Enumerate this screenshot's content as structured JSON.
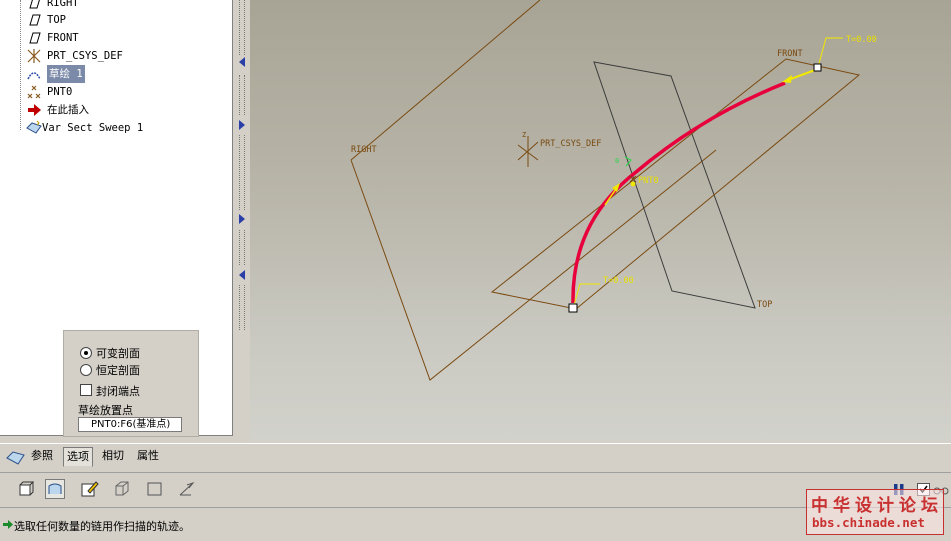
{
  "model_tree": {
    "items": [
      {
        "label": "RIGHT",
        "icon": "datum-plane-icon"
      },
      {
        "label": "TOP",
        "icon": "datum-plane-icon"
      },
      {
        "label": "FRONT",
        "icon": "datum-plane-icon"
      },
      {
        "label": "PRT_CSYS_DEF",
        "icon": "coordinate-system-icon"
      },
      {
        "label": "草绘 1",
        "icon": "sketch-icon",
        "selected": true
      },
      {
        "label": "PNT0",
        "icon": "datum-point-icon"
      },
      {
        "label": "在此插入",
        "icon": "insert-here-arrow-icon"
      },
      {
        "label": "Var Sect Sweep 1",
        "icon": "sweep-feature-icon"
      }
    ]
  },
  "viewport": {
    "labels": {
      "right_plane": "RIGHT",
      "top_plane": "TOP",
      "front_plane": "FRONT",
      "csys": "PRT_CSYS_DEF",
      "csys_axis": "Z",
      "point": "PNT0",
      "t_end": "T=0.00",
      "t_start": "T=0.00"
    },
    "colors": {
      "datum_plane": "#7a4a10",
      "trajectory": "#e8003c",
      "annotation": "#f0e800",
      "top_plane_edge": "#3c3c3c"
    }
  },
  "options_panel": {
    "radio_variable": "可变剖面",
    "radio_constant": "恒定剖面",
    "checkbox_closed_ends": "封闭端点",
    "sketch_placement_label": "草绘放置点",
    "sketch_placement_value": "PNT0:F6(基准点)",
    "selected": "variable"
  },
  "dashboard_tabs": [
    {
      "label": "参照"
    },
    {
      "label": "选项",
      "active": true
    },
    {
      "label": "相切"
    },
    {
      "label": "属性"
    }
  ],
  "toolbar": {
    "tools": [
      "solid-icon",
      "surface-icon",
      "sketch-section-icon",
      "remove-material-icon",
      "thicken-icon",
      "direction-icon"
    ]
  },
  "status": {
    "message": "选取任何数量的链用作扫描的轨迹。"
  },
  "watermark": {
    "title": "中华设计论坛",
    "url": "bbs.chinade.net"
  }
}
